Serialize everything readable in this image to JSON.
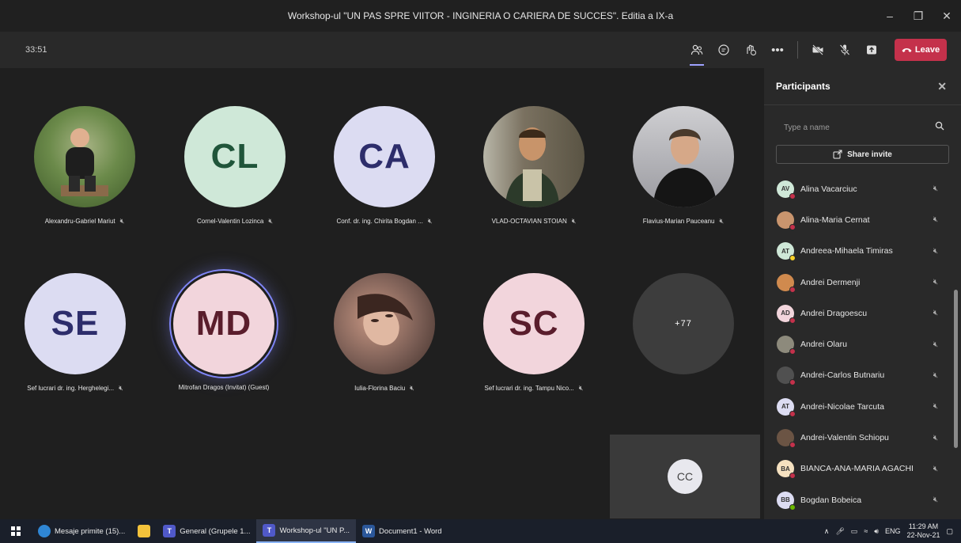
{
  "window": {
    "title": "Workshop-ul \"UN PAS SPRE VIITOR - INGINERIA O CARIERA DE SUCCES\". Editia a IX-a",
    "minimize": "–",
    "restore": "❐",
    "close": "✕"
  },
  "toolbar": {
    "timer": "33:51",
    "leave_label": "Leave",
    "more": "•••"
  },
  "tiles": [
    {
      "name": "Alexandru-Gabriel Mariut",
      "initials": "",
      "bg": "#6b8a4a"
    },
    {
      "name": "Cornel-Valentin Lozinca",
      "initials": "CL",
      "bg": "#cfe8d8",
      "fg": "#20553a"
    },
    {
      "name": "Conf. dr. ing. Chirita Bogdan ...",
      "initials": "CA",
      "bg": "#dcdcf2",
      "fg": "#2d2d6b"
    },
    {
      "name": "VLAD-OCTAVIAN STOIAN",
      "initials": "",
      "bg": "#6d6552"
    },
    {
      "name": "Flavius-Marian Pauceanu",
      "initials": "",
      "bg": "#a9a9ad"
    },
    {
      "name": "Sef lucrari dr. ing. Herghelegi...",
      "initials": "SE",
      "bg": "#dcdcf2",
      "fg": "#2d2d6b"
    },
    {
      "name": "Mitrofan Dragos (Invitat) (Guest)",
      "initials": "MD",
      "bg": "#f2d5dc",
      "fg": "#5a1d2c"
    },
    {
      "name": "Iulia-Florina Baciu",
      "initials": "",
      "bg": "#7b5e55"
    },
    {
      "name": "Sef lucrari dr. ing. Tampu Nico...",
      "initials": "SC",
      "bg": "#f2d5dc",
      "fg": "#5a1d2c"
    },
    {
      "name": "",
      "initials": "+77",
      "bg": "#3d3d3d",
      "fg": "#ffffff"
    }
  ],
  "self_view": {
    "initials": "CC"
  },
  "panel": {
    "title": "Participants",
    "search_placeholder": "Type a name",
    "invite_label": "Share invite",
    "participants": [
      {
        "name": "Alina Vacarciuc",
        "initials": "AV",
        "bg": "#cfe8d8",
        "status": "red"
      },
      {
        "name": "Alina-Maria Cernat",
        "initials": "",
        "bg": "#c9956e",
        "status": "red"
      },
      {
        "name": "Andreea-Mihaela Timiras",
        "initials": "AT",
        "bg": "#cfe8d8",
        "status": "yellow"
      },
      {
        "name": "Andrei Dermenji",
        "initials": "",
        "bg": "#d08a4e",
        "status": "red"
      },
      {
        "name": "Andrei Dragoescu",
        "initials": "AD",
        "bg": "#f2d5dc",
        "status": "red"
      },
      {
        "name": "Andrei Olaru",
        "initials": "",
        "bg": "#8d8a7c",
        "status": "red"
      },
      {
        "name": "Andrei-Carlos Butnariu",
        "initials": "",
        "bg": "#505050",
        "status": "red"
      },
      {
        "name": "Andrei-Nicolae Tarcuta",
        "initials": "AT",
        "bg": "#dcdcf2",
        "status": "red"
      },
      {
        "name": "Andrei-Valentin Schiopu",
        "initials": "",
        "bg": "#6b5444",
        "status": "red"
      },
      {
        "name": "BIANCA-ANA-MARIA AGACHI",
        "initials": "BA",
        "bg": "#f5e1c0",
        "status": "red"
      },
      {
        "name": "Bogdan Bobeica",
        "initials": "BB",
        "bg": "#dcdcf2",
        "status": "green"
      }
    ]
  },
  "taskbar": {
    "items": [
      {
        "label": "Mesaje primite (15)...",
        "icon": "edge-icon",
        "color": "#2f86d4",
        "active": false
      },
      {
        "label": "",
        "icon": "file-explorer-icon",
        "color": "#f3c23b",
        "active": false
      },
      {
        "label": "General (Grupele 1...",
        "icon": "teams-icon",
        "color": "#5059c9",
        "active": false
      },
      {
        "label": "Workshop-ul \"UN P...",
        "icon": "teams-icon",
        "color": "#5059c9",
        "active": true
      },
      {
        "label": "Document1 - Word",
        "icon": "word-icon",
        "color": "#2b579a",
        "active": false
      }
    ],
    "lang": "ENG",
    "time": "11:29 AM",
    "date": "22-Nov-21"
  },
  "colors": {
    "accent": "#7f85f5",
    "leave": "#c4314b",
    "bg": "#1f1f1f",
    "panel": "#292929"
  }
}
